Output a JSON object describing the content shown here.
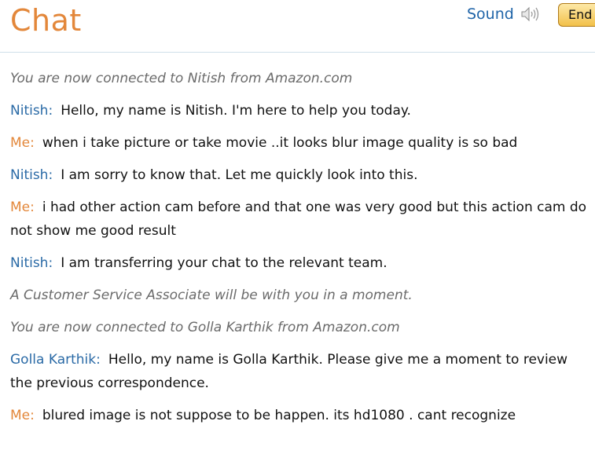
{
  "header": {
    "title": "Chat",
    "sound_label": "Sound",
    "end_label": "End",
    "icons": {
      "speaker": "speaker-volume-icon"
    },
    "colors": {
      "title": "#e3873a",
      "link": "#1f64a8",
      "agent": "#2a6aa6",
      "me": "#e3873a",
      "system": "#6a6a6a"
    }
  },
  "messages": [
    {
      "type": "system",
      "text": "You are now connected to Nitish from Amazon.com"
    },
    {
      "type": "agent",
      "speaker": "Nitish:",
      "text": "Hello, my name is Nitish. I'm here to help you today."
    },
    {
      "type": "me",
      "speaker": "Me:",
      "text": "when i take picture or take movie ..it looks blur image quality is so bad"
    },
    {
      "type": "agent",
      "speaker": "Nitish:",
      "text": "I am sorry to know that. Let me quickly look into this."
    },
    {
      "type": "me",
      "speaker": "Me:",
      "text": "i had other action cam before and that one was very good but this action cam do not show me good result"
    },
    {
      "type": "agent",
      "speaker": "Nitish:",
      "text": "I am transferring your chat to the relevant team."
    },
    {
      "type": "system",
      "text": "A Customer Service Associate will be with you in a moment."
    },
    {
      "type": "system",
      "text": "You are now connected to Golla Karthik from Amazon.com"
    },
    {
      "type": "agent",
      "speaker": "Golla Karthik:",
      "text": "Hello, my name is Golla Karthik. Please give me a moment to review the previous correspondence."
    },
    {
      "type": "me",
      "speaker": "Me:",
      "text": "blured image is not suppose to be happen. its hd1080 . cant recognize"
    }
  ]
}
